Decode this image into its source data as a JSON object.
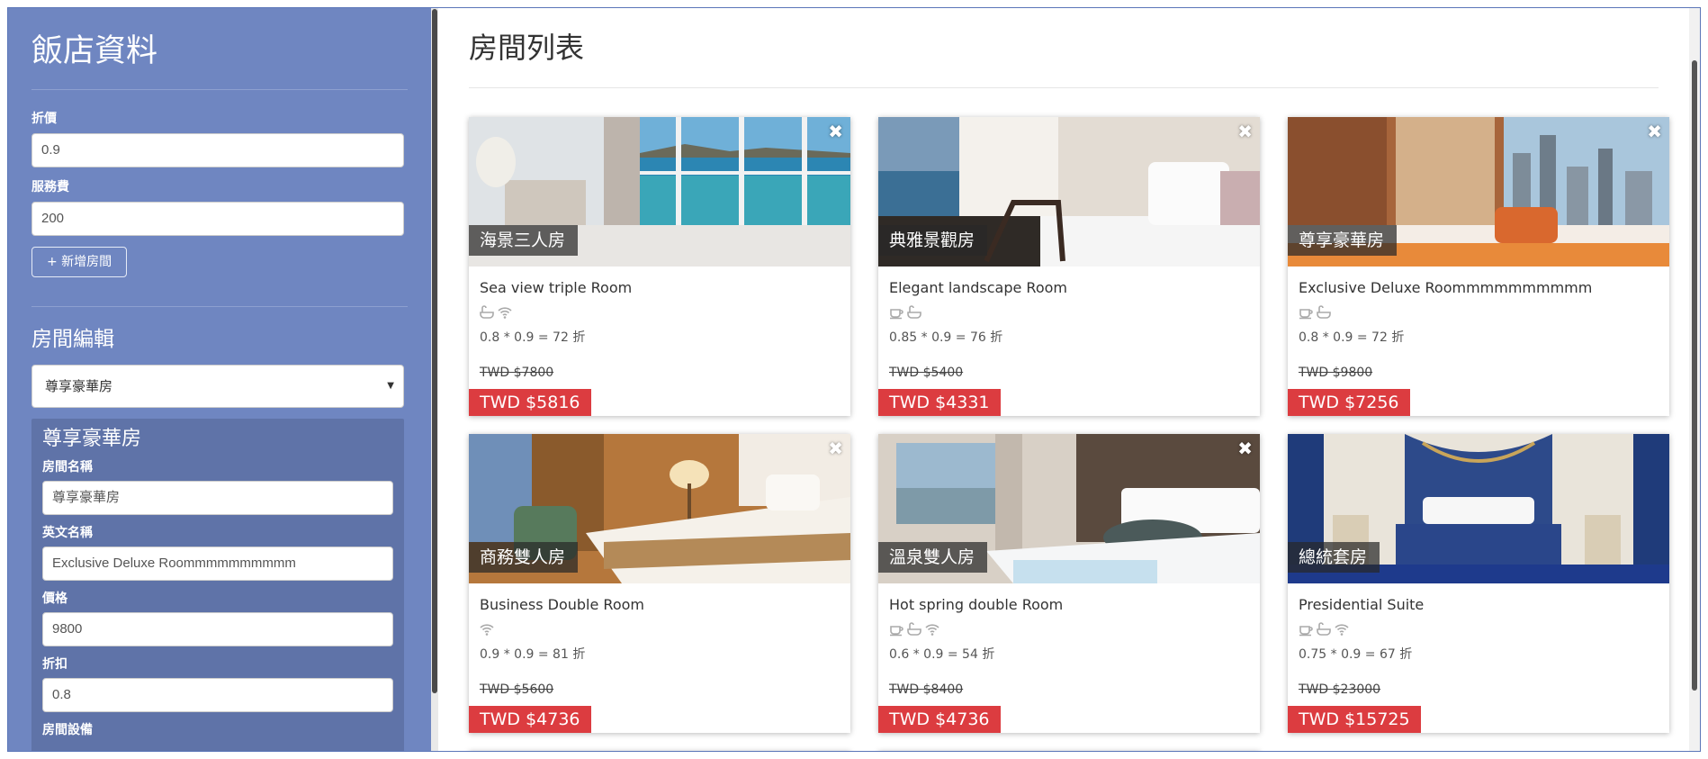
{
  "sidebar": {
    "title": "飯店資料",
    "discount_label": "折價",
    "discount_value": "0.9",
    "service_label": "服務費",
    "service_value": "200",
    "add_room_label": "+ 新增房間",
    "edit_title": "房間編輯",
    "selected_room": "尊享豪華房",
    "edit_panel": {
      "title": "尊享豪華房",
      "name_label": "房間名稱",
      "name_value": "尊享豪華房",
      "en_label": "英文名稱",
      "en_value": "Exclusive Deluxe Roommmmmmmmmm",
      "price_label": "價格",
      "price_value": "9800",
      "discount_label": "折扣",
      "discount_value": "0.8",
      "amenities_label": "房間設備"
    }
  },
  "main": {
    "title": "房間列表",
    "rooms": [
      {
        "name": "海景三人房",
        "en": "Sea view triple Room",
        "amenities": [
          "bath-icon",
          "wifi-icon"
        ],
        "discount": "0.8 * 0.9 = 72 折",
        "original": "TWD $7800",
        "price": "TWD $5816"
      },
      {
        "name": "典雅景觀房",
        "en": "Elegant landscape Room",
        "amenities": [
          "breakfast-icon",
          "bath-icon"
        ],
        "discount": "0.85 * 0.9 = 76 折",
        "original": "TWD $5400",
        "price": "TWD $4331"
      },
      {
        "name": "尊享豪華房",
        "en": "Exclusive Deluxe Roommmmmmmmmm",
        "amenities": [
          "breakfast-icon",
          "bath-icon"
        ],
        "discount": "0.8 * 0.9 = 72 折",
        "original": "TWD $9800",
        "price": "TWD $7256"
      },
      {
        "name": "商務雙人房",
        "en": "Business Double Room",
        "amenities": [
          "wifi-icon"
        ],
        "discount": "0.9 * 0.9 = 81 折",
        "original": "TWD $5600",
        "price": "TWD $4736"
      },
      {
        "name": "溫泉雙人房",
        "en": "Hot spring double Room",
        "amenities": [
          "breakfast-icon",
          "bath-icon",
          "wifi-icon"
        ],
        "discount": "0.6 * 0.9 = 54 折",
        "original": "TWD $8400",
        "price": "TWD $4736"
      },
      {
        "name": "總統套房",
        "en": "Presidential Suite",
        "amenities": [
          "breakfast-icon",
          "bath-icon",
          "wifi-icon"
        ],
        "discount": "0.75 * 0.9 = 67 折",
        "original": "TWD $23000",
        "price": "TWD $15725"
      }
    ]
  },
  "colors": {
    "sidebar_bg": "#6f86c1",
    "edit_panel_bg": "#5f73a8",
    "price_badge": "#dc3c40"
  }
}
